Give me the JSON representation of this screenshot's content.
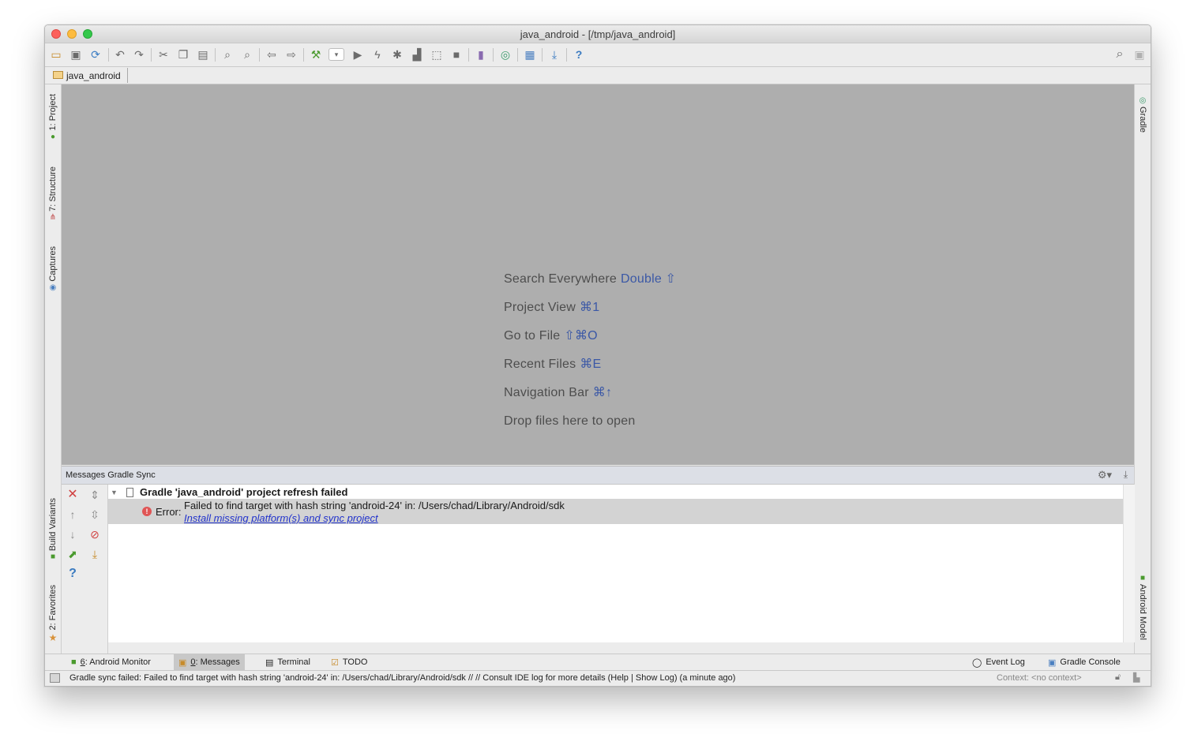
{
  "window": {
    "title": "java_android - [/tmp/java_android]"
  },
  "toolbar": {
    "icons": [
      "open-icon",
      "save-icon",
      "sync-icon",
      "undo-icon",
      "redo-icon",
      "cut-icon",
      "copy-icon",
      "paste-icon",
      "find-icon",
      "replace-icon",
      "back-icon",
      "forward-icon",
      "make-project-icon",
      "run-config-dropdown",
      "run-icon",
      "apply-changes-icon",
      "debug-icon",
      "profile-icon",
      "attach-debugger-icon",
      "stop-icon",
      "avd-manager-icon",
      "sync-gradle-icon",
      "project-structure-icon",
      "sdk-manager-icon",
      "help-icon"
    ],
    "search_icon": "search-icon",
    "user_icon": "user-icon"
  },
  "navbar": {
    "crumb": "java_android"
  },
  "left_tabs": [
    {
      "label": "1: Project"
    },
    {
      "label": "7: Structure"
    },
    {
      "label": "Captures"
    },
    {
      "label": "Build Variants"
    },
    {
      "label": "2: Favorites"
    }
  ],
  "right_tabs": [
    {
      "label": "Gradle"
    },
    {
      "label": "Android Model"
    }
  ],
  "editor": {
    "hints": [
      {
        "text": "Search Everywhere",
        "key": "Double ⇧"
      },
      {
        "text": "Project View",
        "key": "⌘1"
      },
      {
        "text": "Go to File",
        "key": "⇧⌘O"
      },
      {
        "text": "Recent Files",
        "key": "⌘E"
      },
      {
        "text": "Navigation Bar",
        "key": "⌘↑"
      },
      {
        "text": "Drop files here to open",
        "key": ""
      }
    ]
  },
  "messages": {
    "title": "Messages Gradle Sync",
    "root": "Gradle 'java_android' project refresh failed",
    "error_label": "Error:",
    "error_text": "Failed to find target with hash string 'android-24' in: /Users/chad/Library/Android/sdk",
    "error_link": "Install missing platform(s) and sync project"
  },
  "bottom_tabs": {
    "android_monitor": {
      "num": "6",
      "label": ": Android Monitor"
    },
    "messages": {
      "num": "0",
      "label": ": Messages"
    },
    "terminal": "Terminal",
    "todo": "TODO",
    "event_log": "Event Log",
    "gradle_console": "Gradle Console"
  },
  "status": {
    "text": "Gradle sync failed: Failed to find target with hash string 'android-24' in: /Users/chad/Library/Android/sdk // // Consult IDE log for more details (Help | Show Log) (a minute ago)",
    "context": "Context: <no context>"
  },
  "colors": {
    "accent_key": "#3b58a6",
    "error": "#e05555",
    "link": "#2233cc",
    "editor_bg": "#aeaeae"
  }
}
